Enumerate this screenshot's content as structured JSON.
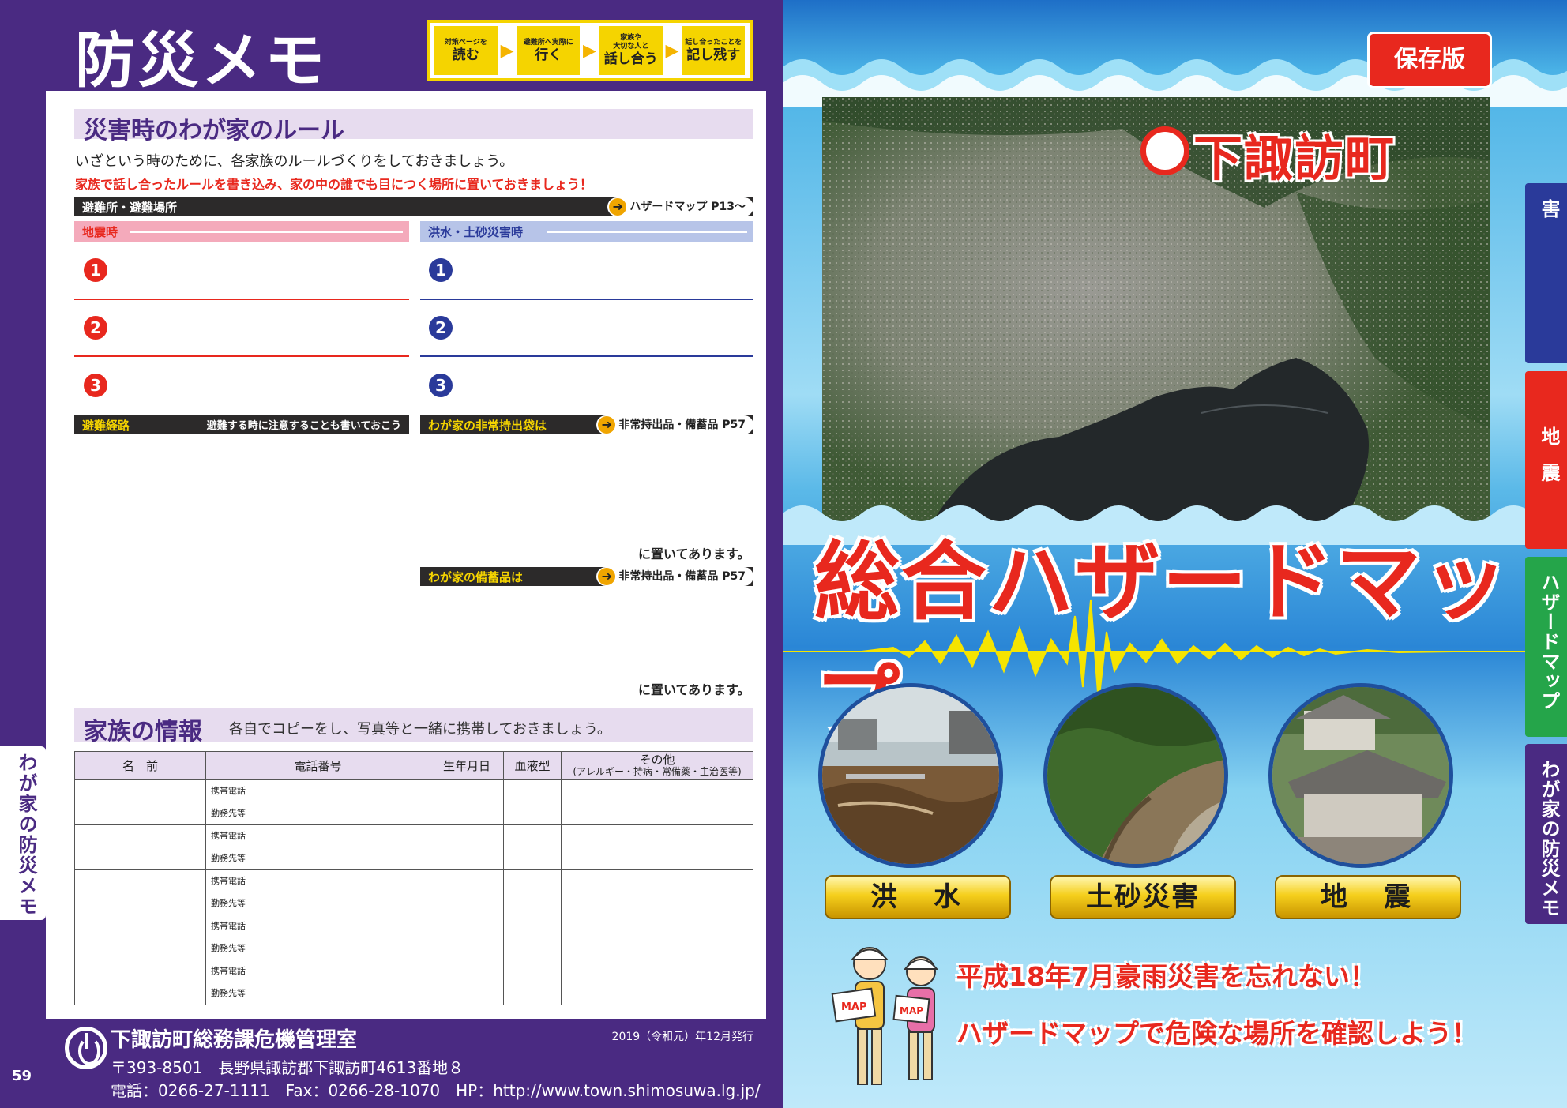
{
  "left": {
    "title": "防災メモ",
    "steps": [
      {
        "small": "対策ページを",
        "big": "読む"
      },
      {
        "small": "避難所へ実際に",
        "big": "行く"
      },
      {
        "small": "家族や\n大切な人と",
        "big": "話し合う"
      },
      {
        "small": "話し合ったことを",
        "big": "記し残す"
      }
    ],
    "rules": {
      "heading": "災害時のわが家のルール",
      "intro": "いざという時のために、各家族のルールづくりをしておきましょう。",
      "note": "家族で話し合ったルールを書き込み、家の中の誰でも目につく場所に置いておきましょう！",
      "shelter_bar": "避難所・避難場所",
      "shelter_ref": "ハザードマップ  P13～",
      "quake_head": "地震時",
      "flood_head": "洪水・土砂災害時",
      "numbers": [
        "1",
        "2",
        "3"
      ],
      "route_bar": "避難経路",
      "route_note": "避難する時に注意することも書いておこう",
      "bag_bar": "わが家の非常持出袋は",
      "bag_ref": "非常持出品・備蓄品  P57",
      "placed_text": "に置いてあります。",
      "stock_bar": "わが家の備蓄品は",
      "stock_ref": "非常持出品・備蓄品  P57"
    },
    "family": {
      "heading": "家族の情報",
      "sub": "各自でコピーをし、写真等と一緒に携帯しておきましょう。",
      "columns": [
        "名　前",
        "電話番号",
        "生年月日",
        "血液型",
        "その他"
      ],
      "other_sub": "(アレルギー・持病・常備薬・主治医等)",
      "phone_labels": [
        "携帯電話",
        "勤務先等"
      ],
      "row_count": 5
    },
    "footer": {
      "org": "下諏訪町総務課危機管理室",
      "date": "2019（令和元）年12月発行",
      "address": "〒393-8501　長野県諏訪郡下諏訪町4613番地８",
      "contact": "電話：0266-27-1111　Fax：0266-28-1070　HP：http://www.town.shimosuwa.lg.jp/",
      "page": "59",
      "side_tab": "わが家の防災メモ"
    }
  },
  "right": {
    "badge": "保存版",
    "town": "下諏訪町",
    "title": "総合ハザードマップ",
    "labels": [
      "洪　水",
      "土砂災害",
      "地　震"
    ],
    "slogan1": "平成18年7月豪雨災害を忘れない！",
    "slogan2": "ハザードマップで危険な場所を確認しよう！",
    "mascot_sign": "MAP",
    "tabs": [
      {
        "label": "洪水・土砂災害",
        "color": "#2a3a9a"
      },
      {
        "label": "地震",
        "color": "#e8281e"
      },
      {
        "label": "ハザードマップ",
        "color": "#25a54a"
      },
      {
        "label": "わが家の防災メモ",
        "color": "#4a2a82"
      }
    ]
  },
  "colors": {
    "purple": "#4a2a82",
    "red": "#e8281e",
    "navy": "#2a3a9a",
    "yellow": "#f5d400"
  }
}
